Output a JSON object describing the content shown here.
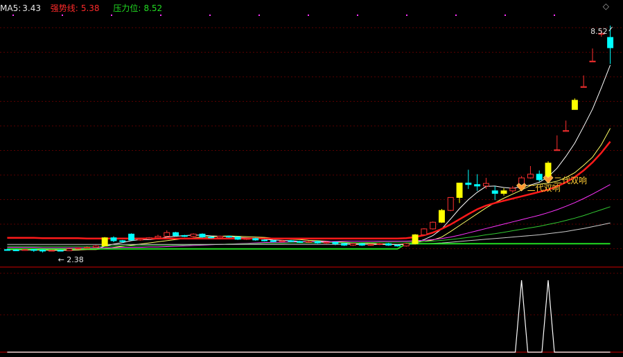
{
  "legend": {
    "ma5": {
      "label": "MA5:",
      "value": "3.43"
    },
    "strong_line": {
      "label": "强势线:",
      "value": "5.38"
    },
    "pressure": {
      "label": "压力位:",
      "value": "8.52"
    }
  },
  "colors": {
    "background": "#000000",
    "rise": "#ff3030",
    "fall": "#00ffff",
    "limit_up": "#ffff00",
    "ma5": "#ffffff",
    "ma10": "#ffff66",
    "strong_line": "#ff1a1a",
    "ma30": "#ff33ff",
    "ma60": "#33cc33",
    "ma120": "#cccccc",
    "pressure_line": "#22dd22",
    "signal_line": "#ffffff",
    "marker": "#ff9933"
  },
  "icons": {
    "corner": "diamond-icon",
    "marker": "heart-icon"
  },
  "chart_data": {
    "type": "candlestick",
    "title": "",
    "ylim": [
      2.1,
      8.8
    ],
    "grid": true,
    "high_label": "8.52",
    "low_label": "2.38",
    "candles": [
      [
        2.46,
        2.45,
        2.48,
        2.43
      ],
      [
        2.45,
        2.44,
        2.47,
        2.42
      ],
      [
        2.44,
        2.46,
        2.48,
        2.43
      ],
      [
        2.46,
        2.45,
        2.47,
        2.4
      ],
      [
        2.45,
        2.42,
        2.46,
        2.38
      ],
      [
        2.42,
        2.44,
        2.45,
        2.41
      ],
      [
        2.44,
        2.43,
        2.46,
        2.42
      ],
      [
        2.43,
        2.48,
        2.5,
        2.42
      ],
      [
        2.48,
        2.5,
        2.52,
        2.47
      ],
      [
        2.5,
        2.52,
        2.54,
        2.49
      ],
      [
        2.52,
        2.56,
        2.58,
        2.51
      ],
      [
        2.56,
        2.78,
        2.8,
        2.55
      ],
      [
        2.78,
        2.7,
        2.82,
        2.66
      ],
      [
        2.7,
        2.68,
        2.72,
        2.64
      ],
      [
        2.88,
        2.72,
        2.9,
        2.71
      ],
      [
        2.72,
        2.75,
        2.77,
        2.7
      ],
      [
        2.75,
        2.78,
        2.8,
        2.73
      ],
      [
        2.78,
        2.82,
        2.86,
        2.76
      ],
      [
        2.82,
        2.92,
        2.98,
        2.8
      ],
      [
        2.92,
        2.84,
        2.94,
        2.82
      ],
      [
        2.84,
        2.82,
        2.86,
        2.8
      ],
      [
        2.82,
        2.88,
        2.9,
        2.8
      ],
      [
        2.88,
        2.8,
        2.9,
        2.78
      ],
      [
        2.8,
        2.78,
        2.82,
        2.76
      ],
      [
        2.78,
        2.82,
        2.84,
        2.76
      ],
      [
        2.82,
        2.8,
        2.84,
        2.78
      ],
      [
        2.8,
        2.74,
        2.82,
        2.72
      ],
      [
        2.74,
        2.76,
        2.78,
        2.72
      ],
      [
        2.76,
        2.72,
        2.78,
        2.7
      ],
      [
        2.72,
        2.7,
        2.74,
        2.68
      ],
      [
        2.7,
        2.68,
        2.72,
        2.66
      ],
      [
        2.68,
        2.7,
        2.72,
        2.66
      ],
      [
        2.7,
        2.68,
        2.72,
        2.66
      ],
      [
        2.68,
        2.66,
        2.7,
        2.64
      ],
      [
        2.66,
        2.68,
        2.7,
        2.64
      ],
      [
        2.68,
        2.64,
        2.7,
        2.62
      ],
      [
        2.64,
        2.66,
        2.68,
        2.62
      ],
      [
        2.66,
        2.62,
        2.68,
        2.58
      ],
      [
        2.62,
        2.58,
        2.64,
        2.56
      ],
      [
        2.58,
        2.62,
        2.64,
        2.56
      ],
      [
        2.62,
        2.58,
        2.64,
        2.56
      ],
      [
        2.58,
        2.6,
        2.62,
        2.56
      ],
      [
        2.6,
        2.62,
        2.64,
        2.58
      ],
      [
        2.62,
        2.58,
        2.64,
        2.56
      ],
      [
        2.58,
        2.56,
        2.6,
        2.54
      ],
      [
        2.56,
        2.62,
        2.64,
        2.54
      ],
      [
        2.62,
        2.86,
        2.88,
        2.6
      ],
      [
        2.86,
        3.02,
        3.04,
        2.84
      ],
      [
        3.02,
        3.2,
        3.22,
        3.0
      ],
      [
        3.2,
        3.52,
        3.56,
        3.18
      ],
      [
        3.52,
        3.87,
        3.87,
        3.5
      ],
      [
        3.87,
        4.26,
        4.26,
        3.72
      ],
      [
        4.26,
        4.22,
        4.62,
        4.1
      ],
      [
        4.22,
        4.18,
        4.5,
        4.05
      ],
      [
        4.18,
        4.25,
        4.4,
        4.1
      ],
      [
        4.05,
        3.98,
        4.18,
        3.8
      ],
      [
        3.98,
        4.05,
        4.12,
        3.92
      ],
      [
        4.05,
        4.12,
        4.18,
        4.0
      ],
      [
        4.12,
        4.4,
        4.45,
        4.08
      ],
      [
        4.4,
        4.5,
        4.72,
        4.38
      ],
      [
        4.5,
        4.35,
        4.6,
        4.3
      ],
      [
        4.35,
        4.8,
        4.85,
        4.32
      ],
      [
        5.16,
        5.16,
        5.55,
        5.16
      ],
      [
        5.68,
        5.68,
        5.95,
        5.68
      ],
      [
        6.25,
        6.5,
        6.55,
        6.25
      ],
      [
        6.87,
        6.87,
        7.17,
        6.87
      ],
      [
        7.56,
        7.56,
        7.9,
        7.56
      ],
      [
        8.31,
        8.31,
        8.4,
        8.22
      ],
      [
        8.2,
        7.92,
        8.52,
        7.48
      ]
    ],
    "limit_up_indices": [
      11,
      46,
      49,
      51,
      56,
      61,
      64
    ],
    "series": [
      {
        "name": "MA5",
        "values": [
          2.46,
          2.46,
          2.45,
          2.45,
          2.45,
          2.44,
          2.44,
          2.44,
          2.45,
          2.47,
          2.48,
          2.55,
          2.61,
          2.65,
          2.7,
          2.73,
          2.73,
          2.75,
          2.8,
          2.82,
          2.84,
          2.85,
          2.85,
          2.83,
          2.82,
          2.82,
          2.79,
          2.78,
          2.77,
          2.74,
          2.72,
          2.71,
          2.7,
          2.68,
          2.68,
          2.67,
          2.66,
          2.65,
          2.64,
          2.62,
          2.61,
          2.6,
          2.6,
          2.6,
          2.59,
          2.6,
          2.65,
          2.73,
          2.84,
          3.02,
          3.29,
          3.57,
          3.81,
          4.01,
          4.17,
          4.18,
          4.14,
          4.12,
          4.16,
          4.21,
          4.28,
          4.43,
          4.66,
          4.98,
          5.34,
          5.79,
          6.26,
          6.84,
          7.45
        ]
      },
      {
        "name": "MA10",
        "values": [
          2.46,
          2.46,
          2.46,
          2.45,
          2.45,
          2.45,
          2.45,
          2.45,
          2.45,
          2.46,
          2.46,
          2.49,
          2.52,
          2.55,
          2.58,
          2.61,
          2.64,
          2.67,
          2.7,
          2.73,
          2.76,
          2.78,
          2.8,
          2.81,
          2.82,
          2.83,
          2.82,
          2.81,
          2.8,
          2.79,
          2.77,
          2.75,
          2.74,
          2.73,
          2.71,
          2.7,
          2.69,
          2.67,
          2.66,
          2.65,
          2.64,
          2.63,
          2.62,
          2.61,
          2.6,
          2.62,
          2.65,
          2.68,
          2.72,
          2.8,
          2.95,
          3.11,
          3.27,
          3.43,
          3.59,
          3.73,
          3.85,
          3.96,
          4.07,
          4.19,
          4.23,
          4.26,
          4.31,
          4.41,
          4.54,
          4.74,
          4.96,
          5.3,
          5.74
        ]
      },
      {
        "name": "强势线",
        "values": [
          2.78,
          2.78,
          2.78,
          2.78,
          2.77,
          2.77,
          2.77,
          2.77,
          2.77,
          2.76,
          2.76,
          2.76,
          2.76,
          2.76,
          2.76,
          2.76,
          2.76,
          2.76,
          2.76,
          2.76,
          2.76,
          2.76,
          2.76,
          2.76,
          2.76,
          2.76,
          2.76,
          2.76,
          2.76,
          2.76,
          2.76,
          2.76,
          2.76,
          2.76,
          2.76,
          2.76,
          2.76,
          2.76,
          2.76,
          2.76,
          2.76,
          2.76,
          2.76,
          2.76,
          2.76,
          2.77,
          2.8,
          2.85,
          2.92,
          3.02,
          3.14,
          3.28,
          3.42,
          3.55,
          3.65,
          3.72,
          3.78,
          3.84,
          3.9,
          3.96,
          4.02,
          4.08,
          4.17,
          4.28,
          4.42,
          4.6,
          4.82,
          5.08,
          5.38
        ]
      },
      {
        "name": "MA30",
        "values": [
          2.52,
          2.52,
          2.52,
          2.52,
          2.51,
          2.51,
          2.51,
          2.51,
          2.51,
          2.51,
          2.51,
          2.51,
          2.51,
          2.52,
          2.52,
          2.52,
          2.53,
          2.53,
          2.54,
          2.55,
          2.56,
          2.57,
          2.58,
          2.59,
          2.6,
          2.61,
          2.62,
          2.63,
          2.64,
          2.65,
          2.66,
          2.66,
          2.67,
          2.67,
          2.68,
          2.68,
          2.68,
          2.68,
          2.69,
          2.69,
          2.69,
          2.69,
          2.69,
          2.69,
          2.69,
          2.69,
          2.7,
          2.71,
          2.73,
          2.76,
          2.8,
          2.85,
          2.91,
          2.97,
          3.03,
          3.09,
          3.15,
          3.21,
          3.27,
          3.33,
          3.39,
          3.46,
          3.54,
          3.63,
          3.73,
          3.84,
          3.96,
          4.09,
          4.22
        ]
      },
      {
        "name": "MA60",
        "values": [
          2.55,
          2.55,
          2.55,
          2.55,
          2.55,
          2.55,
          2.55,
          2.55,
          2.55,
          2.55,
          2.55,
          2.55,
          2.56,
          2.56,
          2.56,
          2.56,
          2.57,
          2.57,
          2.57,
          2.58,
          2.58,
          2.59,
          2.59,
          2.6,
          2.6,
          2.61,
          2.61,
          2.62,
          2.62,
          2.63,
          2.63,
          2.63,
          2.64,
          2.64,
          2.64,
          2.64,
          2.65,
          2.65,
          2.65,
          2.65,
          2.65,
          2.65,
          2.66,
          2.66,
          2.66,
          2.66,
          2.67,
          2.68,
          2.69,
          2.71,
          2.73,
          2.76,
          2.79,
          2.82,
          2.86,
          2.89,
          2.93,
          2.97,
          3.01,
          3.05,
          3.09,
          3.14,
          3.19,
          3.25,
          3.31,
          3.38,
          3.46,
          3.54,
          3.62
        ]
      },
      {
        "name": "MA120",
        "values": [
          2.6,
          2.6,
          2.6,
          2.6,
          2.6,
          2.6,
          2.6,
          2.6,
          2.6,
          2.6,
          2.6,
          2.6,
          2.6,
          2.6,
          2.6,
          2.6,
          2.6,
          2.6,
          2.6,
          2.6,
          2.6,
          2.6,
          2.6,
          2.6,
          2.6,
          2.6,
          2.6,
          2.6,
          2.6,
          2.6,
          2.6,
          2.6,
          2.6,
          2.6,
          2.6,
          2.6,
          2.6,
          2.6,
          2.6,
          2.6,
          2.6,
          2.6,
          2.6,
          2.6,
          2.6,
          2.6,
          2.61,
          2.62,
          2.63,
          2.64,
          2.66,
          2.68,
          2.7,
          2.72,
          2.74,
          2.76,
          2.78,
          2.8,
          2.82,
          2.84,
          2.86,
          2.89,
          2.92,
          2.95,
          2.99,
          3.03,
          3.08,
          3.13,
          3.18
        ]
      },
      {
        "name": "压力位",
        "values": [
          2.48,
          2.48,
          2.48,
          2.48,
          2.48,
          2.48,
          2.48,
          2.48,
          2.48,
          2.48,
          2.48,
          2.48,
          2.48,
          2.48,
          2.48,
          2.48,
          2.48,
          2.48,
          2.48,
          2.48,
          2.48,
          2.48,
          2.48,
          2.48,
          2.48,
          2.48,
          2.48,
          2.48,
          2.48,
          2.48,
          2.48,
          2.48,
          2.48,
          2.48,
          2.48,
          2.48,
          2.48,
          2.48,
          2.48,
          2.48,
          2.48,
          2.48,
          2.48,
          2.48,
          2.48,
          2.62,
          2.62,
          2.62,
          2.62,
          2.62,
          2.62,
          2.62,
          2.62,
          2.62,
          2.62,
          2.62,
          2.62,
          2.62,
          2.62,
          2.62,
          2.62,
          2.62,
          2.62,
          2.62,
          2.62,
          2.62,
          2.62,
          2.62,
          2.62
        ]
      }
    ],
    "signal": {
      "values": [
        0,
        0,
        0,
        0,
        0,
        0,
        0,
        0,
        0,
        0,
        0,
        0,
        0,
        0,
        0,
        0,
        0,
        0,
        0,
        0,
        0,
        0,
        0,
        0,
        0,
        0,
        0,
        0,
        0,
        0,
        0,
        0,
        0,
        0,
        0,
        0,
        0,
        0,
        0,
        0,
        0,
        0,
        0,
        0,
        0,
        0,
        0,
        0,
        0,
        0,
        0,
        0,
        0,
        0,
        0,
        0,
        0,
        0,
        0,
        0,
        0,
        0,
        0,
        0,
        0,
        0,
        0,
        0,
        0
      ],
      "peaks": [
        58,
        61
      ],
      "ylim": [
        0,
        1
      ]
    },
    "annotations": [
      {
        "text": "二代双响",
        "index": 58,
        "y": 4.12
      },
      {
        "text": "二代双响",
        "index": 61,
        "y": 4.33
      }
    ]
  }
}
